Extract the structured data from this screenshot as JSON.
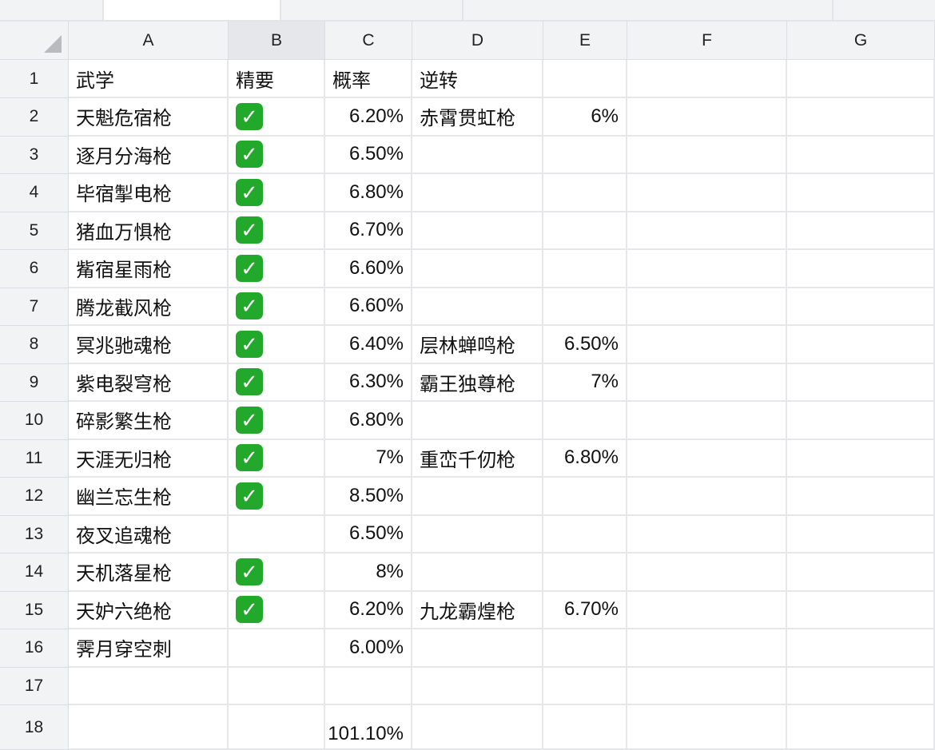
{
  "columns": [
    "A",
    "B",
    "C",
    "D",
    "E",
    "F",
    "G"
  ],
  "selected_column": "B",
  "rows": [
    {
      "n": "1",
      "a": "武学",
      "b": "精要",
      "c": "概率",
      "d": "逆转",
      "e": ""
    },
    {
      "n": "2",
      "a": "天魁危宿枪",
      "b": "✓",
      "c": "6.20%",
      "d": "赤霄贯虹枪",
      "e": "6%"
    },
    {
      "n": "3",
      "a": "逐月分海枪",
      "b": "✓",
      "c": "6.50%",
      "d": "",
      "e": ""
    },
    {
      "n": "4",
      "a": "毕宿掣电枪",
      "b": "✓",
      "c": "6.80%",
      "d": "",
      "e": ""
    },
    {
      "n": "5",
      "a": "猪血万惧枪",
      "b": "✓",
      "c": "6.70%",
      "d": "",
      "e": ""
    },
    {
      "n": "6",
      "a": "觜宿星雨枪",
      "b": "✓",
      "c": "6.60%",
      "d": "",
      "e": ""
    },
    {
      "n": "7",
      "a": "腾龙截风枪",
      "b": "✓",
      "c": "6.60%",
      "d": "",
      "e": ""
    },
    {
      "n": "8",
      "a": "冥兆驰魂枪",
      "b": "✓",
      "c": "6.40%",
      "d": "层林蝉鸣枪",
      "e": "6.50%"
    },
    {
      "n": "9",
      "a": "紫电裂穹枪",
      "b": "✓",
      "c": "6.30%",
      "d": "霸王独尊枪",
      "e": "7%"
    },
    {
      "n": "10",
      "a": "碎影繁生枪",
      "b": "✓",
      "c": "6.80%",
      "d": "",
      "e": ""
    },
    {
      "n": "11",
      "a": "天涯无归枪",
      "b": "✓",
      "c": "7%",
      "d": "重峦千仞枪",
      "e": "6.80%"
    },
    {
      "n": "12",
      "a": "幽兰忘生枪",
      "b": "✓",
      "c": "8.50%",
      "d": "",
      "e": ""
    },
    {
      "n": "13",
      "a": "夜叉追魂枪",
      "b": "",
      "c": "6.50%",
      "d": "",
      "e": ""
    },
    {
      "n": "14",
      "a": "天机落星枪",
      "b": "✓",
      "c": "8%",
      "d": "",
      "e": ""
    },
    {
      "n": "15",
      "a": "天妒六绝枪",
      "b": "✓",
      "c": "6.20%",
      "d": "九龙霸煌枪",
      "e": "6.70%"
    },
    {
      "n": "16",
      "a": "霁月穿空刺",
      "b": "",
      "c": "6.00%",
      "d": "",
      "e": ""
    },
    {
      "n": "17",
      "a": "",
      "b": "",
      "c": "",
      "d": "",
      "e": ""
    },
    {
      "n": "18",
      "a": "",
      "b": "",
      "c": "101.10%",
      "d": "",
      "e": ""
    }
  ],
  "check_color": "#22a82a"
}
